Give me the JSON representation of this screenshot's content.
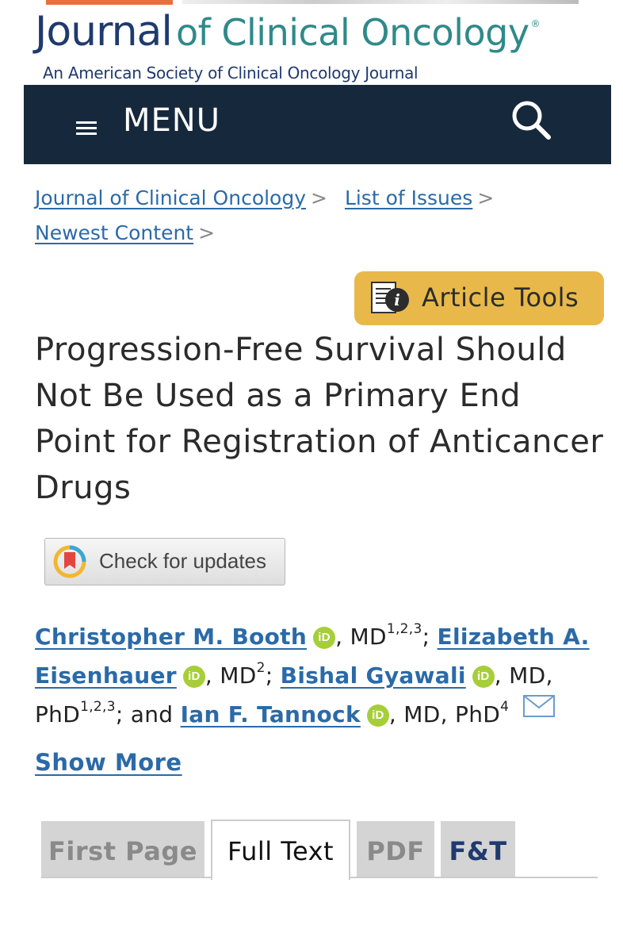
{
  "header": {
    "logo_journal": "Journal",
    "logo_rest": "of Clinical Oncology",
    "logo_registered": "®",
    "subtitle": "An American Society of Clinical Oncology Journal"
  },
  "nav": {
    "menu_label": "MENU",
    "menu_icon": "hamburger-icon",
    "search_icon": "search-icon",
    "background": "#16283c"
  },
  "breadcrumb": {
    "items": [
      "Journal of Clinical Oncology",
      "List of Issues",
      "Newest Content"
    ],
    "separator": ">"
  },
  "article_tools": {
    "label": "Article Tools",
    "icon": "info-document-icon",
    "color": "#e8b84a"
  },
  "article": {
    "title": "Progression-Free Survival Should Not Be Used as a Primary End Point for Registration of Anticancer Drugs"
  },
  "check_updates": {
    "label": "Check for updates"
  },
  "authors": {
    "a1_name": "Christopher M. Booth",
    "a1_deg": ", MD",
    "a1_sup": "1,2,3",
    "sep1": ";",
    "a2_name": "Elizabeth A. Eisenhauer",
    "a2_deg": ", MD",
    "a2_sup": "2",
    "sep2": ";",
    "a3_name": "Bishal Gyawali",
    "a3_deg": ", MD, PhD",
    "a3_sup": "1,2,3",
    "sep3": "; and",
    "a4_name": "Ian F. Tannock",
    "a4_deg": ", MD, PhD",
    "a4_sup": "4",
    "orcid_label": "iD"
  },
  "show_more": "Show More",
  "tabs": [
    {
      "label": "First Page",
      "active": false
    },
    {
      "label": "Full Text",
      "active": true
    },
    {
      "label": "PDF",
      "active": false
    },
    {
      "label": "F&T",
      "active": false
    }
  ]
}
